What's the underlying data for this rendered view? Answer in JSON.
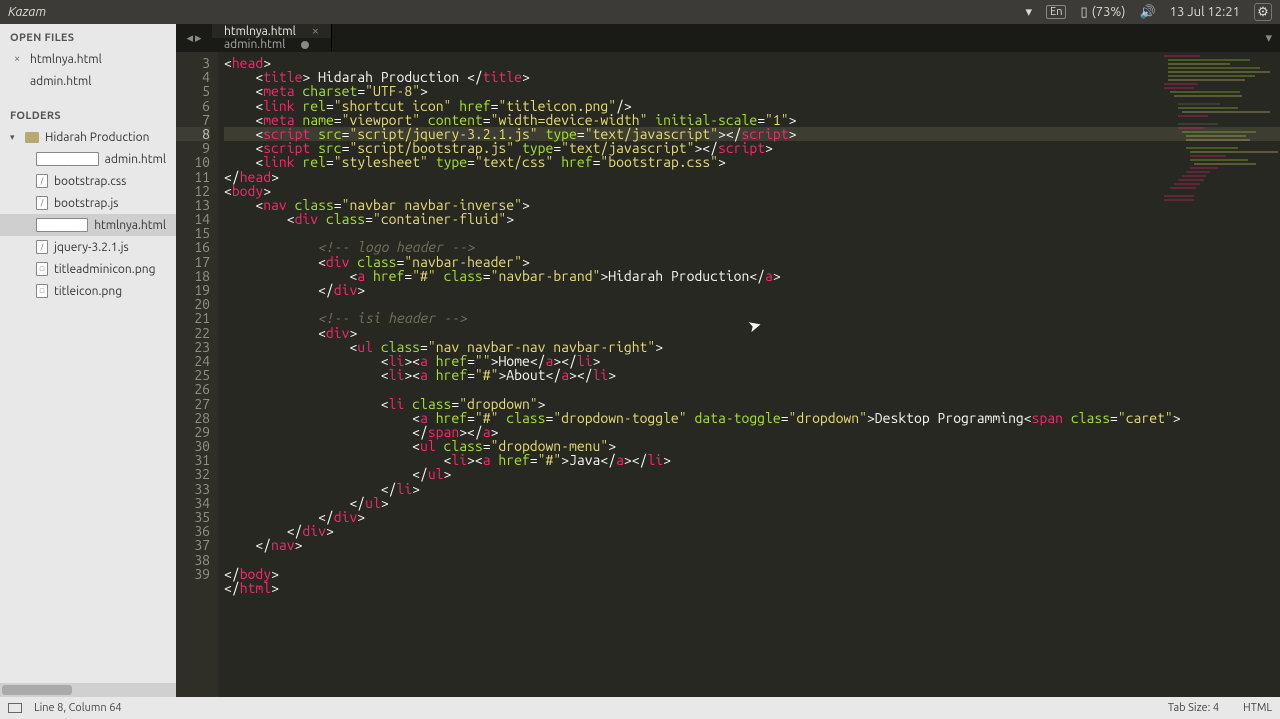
{
  "sysbar": {
    "title": "Kazam",
    "lang": "En",
    "battery": "(73%)",
    "datetime": "13 Jul 12:21"
  },
  "sidebar": {
    "open_files_header": "OPEN FILES",
    "open_files": [
      {
        "name": "htmlnya.html",
        "dirty": false,
        "closable": true
      },
      {
        "name": "admin.html",
        "dirty": false,
        "closable": false
      }
    ],
    "folders_header": "FOLDERS",
    "root_folder": "Hidarah Production",
    "files": [
      {
        "name": "admin.html",
        "kind": "code"
      },
      {
        "name": "bootstrap.css",
        "kind": "css"
      },
      {
        "name": "bootstrap.js",
        "kind": "js"
      },
      {
        "name": "htmlnya.html",
        "kind": "code",
        "selected": true
      },
      {
        "name": "jquery-3.2.1.js",
        "kind": "js"
      },
      {
        "name": "titleadminicon.png",
        "kind": "img"
      },
      {
        "name": "titleicon.png",
        "kind": "img"
      }
    ]
  },
  "tabs": [
    {
      "label": "htmlnya.html",
      "active": true,
      "dirty": false
    },
    {
      "label": "admin.html",
      "active": false,
      "dirty": true
    }
  ],
  "line_numbers_start": 3,
  "line_numbers_end": 39,
  "highlighted_line": 8,
  "code_lines": [
    [
      [
        "p",
        "<"
      ],
      [
        "t",
        "head"
      ],
      [
        "p",
        ">"
      ]
    ],
    [
      [
        "p",
        "    <"
      ],
      [
        "t",
        "title"
      ],
      [
        "p",
        "> "
      ],
      [
        "tx",
        "Hidarah Production "
      ],
      [
        "p",
        "</"
      ],
      [
        "t",
        "title"
      ],
      [
        "p",
        ">"
      ]
    ],
    [
      [
        "p",
        "    <"
      ],
      [
        "t",
        "meta"
      ],
      [
        "p",
        " "
      ],
      [
        "a",
        "charset"
      ],
      [
        "p",
        "="
      ],
      [
        "s",
        "\"UTF-8\""
      ],
      [
        "p",
        ">"
      ]
    ],
    [
      [
        "p",
        "    <"
      ],
      [
        "t",
        "link"
      ],
      [
        "p",
        " "
      ],
      [
        "a",
        "rel"
      ],
      [
        "p",
        "="
      ],
      [
        "s",
        "\"shortcut icon\""
      ],
      [
        "p",
        " "
      ],
      [
        "a",
        "href"
      ],
      [
        "p",
        "="
      ],
      [
        "s",
        "\"titleicon.png\""
      ],
      [
        "p",
        "/>"
      ]
    ],
    [
      [
        "p",
        "    <"
      ],
      [
        "t",
        "meta"
      ],
      [
        "p",
        " "
      ],
      [
        "a",
        "name"
      ],
      [
        "p",
        "="
      ],
      [
        "s",
        "\"viewport\""
      ],
      [
        "p",
        " "
      ],
      [
        "a",
        "content"
      ],
      [
        "p",
        "="
      ],
      [
        "s",
        "\"width=device-width\""
      ],
      [
        "p",
        " "
      ],
      [
        "a",
        "initial-scale"
      ],
      [
        "p",
        "="
      ],
      [
        "s",
        "\"1\""
      ],
      [
        "p",
        ">"
      ]
    ],
    [
      [
        "p",
        "    <"
      ],
      [
        "t",
        "script"
      ],
      [
        "p",
        " "
      ],
      [
        "a",
        "src"
      ],
      [
        "p",
        "="
      ],
      [
        "s",
        "\"script/jquery-3.2.1.js\""
      ],
      [
        "p",
        " "
      ],
      [
        "a",
        "type"
      ],
      [
        "p",
        "="
      ],
      [
        "s",
        "\"text/javascript\""
      ],
      [
        "p",
        "></"
      ],
      [
        "t",
        "script"
      ],
      [
        "p",
        ">"
      ]
    ],
    [
      [
        "p",
        "    <"
      ],
      [
        "t",
        "script"
      ],
      [
        "p",
        " "
      ],
      [
        "a",
        "src"
      ],
      [
        "p",
        "="
      ],
      [
        "s",
        "\"script/bootstrap.js\""
      ],
      [
        "p",
        " "
      ],
      [
        "a",
        "type"
      ],
      [
        "p",
        "="
      ],
      [
        "s",
        "\"text/javascript\""
      ],
      [
        "p",
        "></"
      ],
      [
        "t",
        "script"
      ],
      [
        "p",
        ">"
      ]
    ],
    [
      [
        "p",
        "    <"
      ],
      [
        "t",
        "link"
      ],
      [
        "p",
        " "
      ],
      [
        "a",
        "rel"
      ],
      [
        "p",
        "="
      ],
      [
        "s",
        "\"stylesheet\""
      ],
      [
        "p",
        " "
      ],
      [
        "a",
        "type"
      ],
      [
        "p",
        "="
      ],
      [
        "s",
        "\"text/css\""
      ],
      [
        "p",
        " "
      ],
      [
        "a",
        "href"
      ],
      [
        "p",
        "="
      ],
      [
        "s",
        "\"bootstrap.css\""
      ],
      [
        "p",
        ">"
      ]
    ],
    [
      [
        "p",
        "</"
      ],
      [
        "t",
        "head"
      ],
      [
        "p",
        ">"
      ]
    ],
    [
      [
        "p",
        "<"
      ],
      [
        "t",
        "body"
      ],
      [
        "p",
        ">"
      ]
    ],
    [
      [
        "p",
        "    <"
      ],
      [
        "t",
        "nav"
      ],
      [
        "p",
        " "
      ],
      [
        "a",
        "class"
      ],
      [
        "p",
        "="
      ],
      [
        "s",
        "\"navbar navbar-inverse\""
      ],
      [
        "p",
        ">"
      ]
    ],
    [
      [
        "p",
        "        <"
      ],
      [
        "t",
        "div"
      ],
      [
        "p",
        " "
      ],
      [
        "a",
        "class"
      ],
      [
        "p",
        "="
      ],
      [
        "s",
        "\"container-fluid\""
      ],
      [
        "p",
        ">"
      ]
    ],
    [],
    [
      [
        "p",
        "            "
      ],
      [
        "c",
        "<!-- logo header -->"
      ]
    ],
    [
      [
        "p",
        "            <"
      ],
      [
        "t",
        "div"
      ],
      [
        "p",
        " "
      ],
      [
        "a",
        "class"
      ],
      [
        "p",
        "="
      ],
      [
        "s",
        "\"navbar-header\""
      ],
      [
        "p",
        ">"
      ]
    ],
    [
      [
        "p",
        "                <"
      ],
      [
        "t",
        "a"
      ],
      [
        "p",
        " "
      ],
      [
        "a",
        "href"
      ],
      [
        "p",
        "="
      ],
      [
        "s",
        "\"#\""
      ],
      [
        "p",
        " "
      ],
      [
        "a",
        "class"
      ],
      [
        "p",
        "="
      ],
      [
        "s",
        "\"navbar-brand\""
      ],
      [
        "p",
        ">"
      ],
      [
        "tx",
        "Hidarah Production"
      ],
      [
        "p",
        "</"
      ],
      [
        "t",
        "a"
      ],
      [
        "p",
        ">"
      ]
    ],
    [
      [
        "p",
        "            </"
      ],
      [
        "t",
        "div"
      ],
      [
        "p",
        ">"
      ]
    ],
    [],
    [
      [
        "p",
        "            "
      ],
      [
        "c",
        "<!-- isi header -->"
      ]
    ],
    [
      [
        "p",
        "            <"
      ],
      [
        "t",
        "div"
      ],
      [
        "p",
        ">"
      ]
    ],
    [
      [
        "p",
        "                <"
      ],
      [
        "t",
        "ul"
      ],
      [
        "p",
        " "
      ],
      [
        "a",
        "class"
      ],
      [
        "p",
        "="
      ],
      [
        "s",
        "\"nav navbar-nav navbar-right\""
      ],
      [
        "p",
        ">"
      ]
    ],
    [
      [
        "p",
        "                    <"
      ],
      [
        "t",
        "li"
      ],
      [
        "p",
        "><"
      ],
      [
        "t",
        "a"
      ],
      [
        "p",
        " "
      ],
      [
        "a",
        "href"
      ],
      [
        "p",
        "="
      ],
      [
        "s",
        "\"\""
      ],
      [
        "p",
        ">"
      ],
      [
        "tx",
        "Home"
      ],
      [
        "p",
        "</"
      ],
      [
        "t",
        "a"
      ],
      [
        "p",
        "></"
      ],
      [
        "t",
        "li"
      ],
      [
        "p",
        ">"
      ]
    ],
    [
      [
        "p",
        "                    <"
      ],
      [
        "t",
        "li"
      ],
      [
        "p",
        "><"
      ],
      [
        "t",
        "a"
      ],
      [
        "p",
        " "
      ],
      [
        "a",
        "href"
      ],
      [
        "p",
        "="
      ],
      [
        "s",
        "\"#\""
      ],
      [
        "p",
        ">"
      ],
      [
        "tx",
        "About"
      ],
      [
        "p",
        "</"
      ],
      [
        "t",
        "a"
      ],
      [
        "p",
        "></"
      ],
      [
        "t",
        "li"
      ],
      [
        "p",
        ">"
      ]
    ],
    [],
    [
      [
        "p",
        "                    <"
      ],
      [
        "t",
        "li"
      ],
      [
        "p",
        " "
      ],
      [
        "a",
        "class"
      ],
      [
        "p",
        "="
      ],
      [
        "s",
        "\"dropdown\""
      ],
      [
        "p",
        ">"
      ]
    ],
    [
      [
        "p",
        "                        <"
      ],
      [
        "t",
        "a"
      ],
      [
        "p",
        " "
      ],
      [
        "a",
        "href"
      ],
      [
        "p",
        "="
      ],
      [
        "s",
        "\"#\""
      ],
      [
        "p",
        " "
      ],
      [
        "a",
        "class"
      ],
      [
        "p",
        "="
      ],
      [
        "s",
        "\"dropdown-toggle\""
      ],
      [
        "p",
        " "
      ],
      [
        "a",
        "data-toggle"
      ],
      [
        "p",
        "="
      ],
      [
        "s",
        "\"dropdown\""
      ],
      [
        "p",
        ">"
      ],
      [
        "tx",
        "Desktop Programming"
      ],
      [
        "p",
        "<"
      ],
      [
        "t",
        "span"
      ],
      [
        "p",
        " "
      ],
      [
        "a",
        "class"
      ],
      [
        "p",
        "="
      ],
      [
        "s",
        "\"caret\""
      ],
      [
        "p",
        ">"
      ]
    ],
    [
      [
        "p",
        "                        </"
      ],
      [
        "t",
        "span"
      ],
      [
        "p",
        "></"
      ],
      [
        "t",
        "a"
      ],
      [
        "p",
        ">"
      ]
    ],
    [
      [
        "p",
        "                        <"
      ],
      [
        "t",
        "ul"
      ],
      [
        "p",
        " "
      ],
      [
        "a",
        "class"
      ],
      [
        "p",
        "="
      ],
      [
        "s",
        "\"dropdown-menu\""
      ],
      [
        "p",
        ">"
      ]
    ],
    [
      [
        "p",
        "                            <"
      ],
      [
        "t",
        "li"
      ],
      [
        "p",
        "><"
      ],
      [
        "t",
        "a"
      ],
      [
        "p",
        " "
      ],
      [
        "a",
        "href"
      ],
      [
        "p",
        "="
      ],
      [
        "s",
        "\"#\""
      ],
      [
        "p",
        ">"
      ],
      [
        "tx",
        "Java"
      ],
      [
        "p",
        "</"
      ],
      [
        "t",
        "a"
      ],
      [
        "p",
        "></"
      ],
      [
        "t",
        "li"
      ],
      [
        "p",
        ">"
      ]
    ],
    [
      [
        "p",
        "                        </"
      ],
      [
        "t",
        "ul"
      ],
      [
        "p",
        ">"
      ]
    ],
    [
      [
        "p",
        "                    </"
      ],
      [
        "t",
        "li"
      ],
      [
        "p",
        ">"
      ]
    ],
    [
      [
        "p",
        "                </"
      ],
      [
        "t",
        "ul"
      ],
      [
        "p",
        ">"
      ]
    ],
    [
      [
        "p",
        "            </"
      ],
      [
        "t",
        "div"
      ],
      [
        "p",
        ">"
      ]
    ],
    [
      [
        "p",
        "        </"
      ],
      [
        "t",
        "div"
      ],
      [
        "p",
        ">"
      ]
    ],
    [
      [
        "p",
        "    </"
      ],
      [
        "t",
        "nav"
      ],
      [
        "p",
        ">"
      ]
    ],
    [],
    [
      [
        "p",
        "</"
      ],
      [
        "t",
        "body"
      ],
      [
        "p",
        ">"
      ]
    ],
    [
      [
        "p",
        "</"
      ],
      [
        "t",
        "html"
      ],
      [
        "p",
        ">"
      ]
    ]
  ],
  "status": {
    "pos": "Line 8, Column 64",
    "tab": "Tab Size: 4",
    "lang": "HTML"
  }
}
